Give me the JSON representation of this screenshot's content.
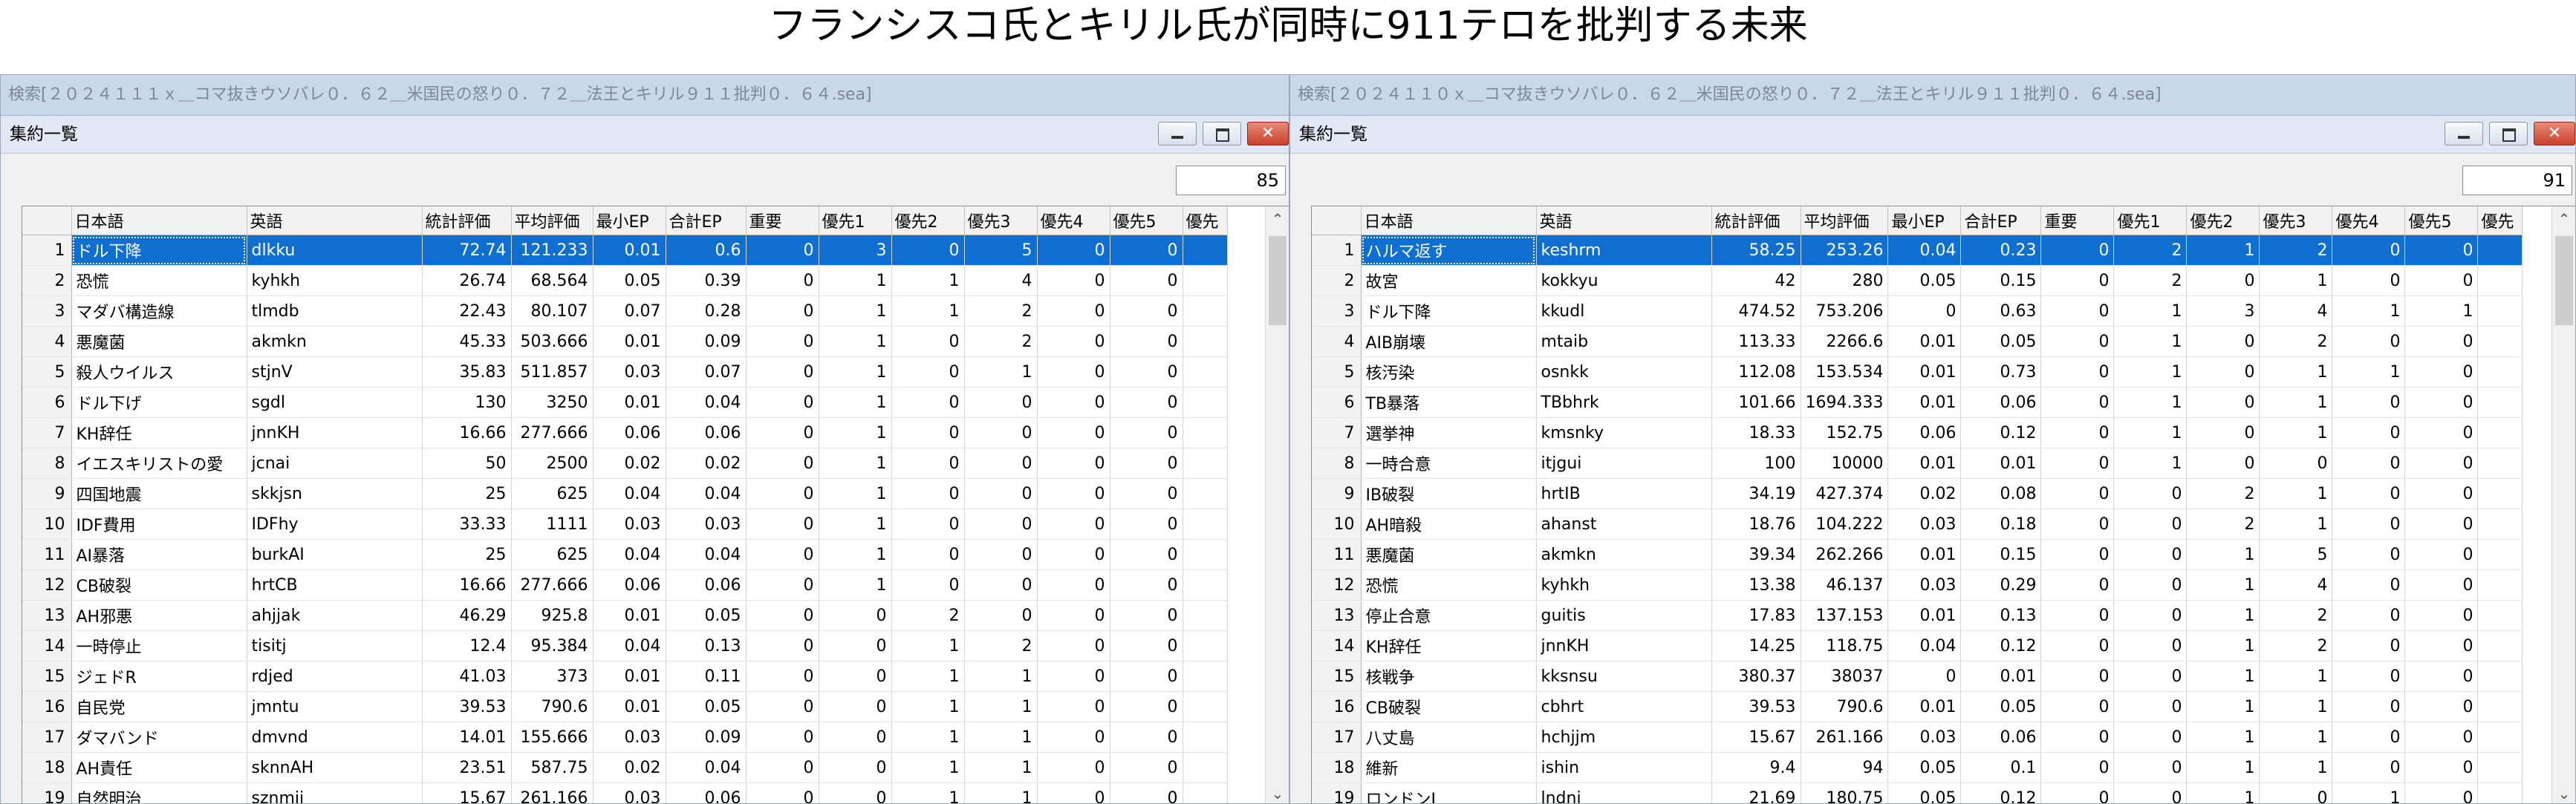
{
  "page_title": "フランシスコ氏とキリル氏が同時に911テロを批判する未来",
  "columns": [
    "日本語",
    "英語",
    "統計評価",
    "平均評価",
    "最小EP",
    "合計EP",
    "重要",
    "優先1",
    "優先2",
    "優先3",
    "優先4",
    "優先5",
    "優先"
  ],
  "panels": [
    {
      "window_title": "検索[２０２４１１１ｘ＿コマ抜きウソバレ０．６２＿米国民の怒り０．７２＿法王とキリル９１１批判０．６４.sea]",
      "subwindow_title": "集約一覧",
      "count": "85",
      "rows": [
        [
          "1",
          "ドル下降",
          "dlkku",
          "72.74",
          "121.233",
          "0.01",
          "0.6",
          "0",
          "3",
          "0",
          "5",
          "0",
          "0"
        ],
        [
          "2",
          "恐慌",
          "kyhkh",
          "26.74",
          "68.564",
          "0.05",
          "0.39",
          "0",
          "1",
          "1",
          "4",
          "0",
          "0"
        ],
        [
          "3",
          "マダバ構造線",
          "tlmdb",
          "22.43",
          "80.107",
          "0.07",
          "0.28",
          "0",
          "1",
          "1",
          "2",
          "0",
          "0"
        ],
        [
          "4",
          "悪魔菌",
          "akmkn",
          "45.33",
          "503.666",
          "0.01",
          "0.09",
          "0",
          "1",
          "0",
          "2",
          "0",
          "0"
        ],
        [
          "5",
          "殺人ウイルス",
          "stjnV",
          "35.83",
          "511.857",
          "0.03",
          "0.07",
          "0",
          "1",
          "0",
          "1",
          "0",
          "0"
        ],
        [
          "6",
          "ドル下げ",
          "sgdl",
          "130",
          "3250",
          "0.01",
          "0.04",
          "0",
          "1",
          "0",
          "0",
          "0",
          "0"
        ],
        [
          "7",
          "KH辞任",
          "jnnKH",
          "16.66",
          "277.666",
          "0.06",
          "0.06",
          "0",
          "1",
          "0",
          "0",
          "0",
          "0"
        ],
        [
          "8",
          "イエスキリストの愛",
          "jcnai",
          "50",
          "2500",
          "0.02",
          "0.02",
          "0",
          "1",
          "0",
          "0",
          "0",
          "0"
        ],
        [
          "9",
          "四国地震",
          "skkjsn",
          "25",
          "625",
          "0.04",
          "0.04",
          "0",
          "1",
          "0",
          "0",
          "0",
          "0"
        ],
        [
          "10",
          "IDF費用",
          "IDFhy",
          "33.33",
          "1111",
          "0.03",
          "0.03",
          "0",
          "1",
          "0",
          "0",
          "0",
          "0"
        ],
        [
          "11",
          "AI暴落",
          "burkAI",
          "25",
          "625",
          "0.04",
          "0.04",
          "0",
          "1",
          "0",
          "0",
          "0",
          "0"
        ],
        [
          "12",
          "CB破裂",
          "hrtCB",
          "16.66",
          "277.666",
          "0.06",
          "0.06",
          "0",
          "1",
          "0",
          "0",
          "0",
          "0"
        ],
        [
          "13",
          "AH邪悪",
          "ahjjak",
          "46.29",
          "925.8",
          "0.01",
          "0.05",
          "0",
          "0",
          "2",
          "0",
          "0",
          "0"
        ],
        [
          "14",
          "一時停止",
          "tisitj",
          "12.4",
          "95.384",
          "0.04",
          "0.13",
          "0",
          "0",
          "1",
          "2",
          "0",
          "0"
        ],
        [
          "15",
          "ジェドR",
          "rdjed",
          "41.03",
          "373",
          "0.01",
          "0.11",
          "0",
          "0",
          "1",
          "1",
          "0",
          "0"
        ],
        [
          "16",
          "自民党",
          "jmntu",
          "39.53",
          "790.6",
          "0.01",
          "0.05",
          "0",
          "0",
          "1",
          "1",
          "0",
          "0"
        ],
        [
          "17",
          "ダマバンド",
          "dmvnd",
          "14.01",
          "155.666",
          "0.03",
          "0.09",
          "0",
          "0",
          "1",
          "1",
          "0",
          "0"
        ],
        [
          "18",
          "AH責任",
          "sknnAH",
          "23.51",
          "587.75",
          "0.02",
          "0.04",
          "0",
          "0",
          "1",
          "1",
          "0",
          "0"
        ],
        [
          "19",
          "自然明治",
          "sznmij",
          "15.67",
          "261.166",
          "0.03",
          "0.06",
          "0",
          "0",
          "1",
          "1",
          "0",
          "0"
        ]
      ]
    },
    {
      "window_title": "検索[２０２４１１０ｘ＿コマ抜きウソバレ０．６２＿米国民の怒り０．７２＿法王とキリル９１１批判０．６４.sea]",
      "subwindow_title": "集約一覧",
      "count": "91",
      "rows": [
        [
          "1",
          "ハルマ返す",
          "keshrm",
          "58.25",
          "253.26",
          "0.04",
          "0.23",
          "0",
          "2",
          "1",
          "2",
          "0",
          "0"
        ],
        [
          "2",
          "故宮",
          "kokkyu",
          "42",
          "280",
          "0.05",
          "0.15",
          "0",
          "2",
          "0",
          "1",
          "0",
          "0"
        ],
        [
          "3",
          "ドル下降",
          "kkudl",
          "474.52",
          "753.206",
          "0",
          "0.63",
          "0",
          "1",
          "3",
          "4",
          "1",
          "1"
        ],
        [
          "4",
          "AIB崩壊",
          "mtaib",
          "113.33",
          "2266.6",
          "0.01",
          "0.05",
          "0",
          "1",
          "0",
          "2",
          "0",
          "0"
        ],
        [
          "5",
          "核汚染",
          "osnkk",
          "112.08",
          "153.534",
          "0.01",
          "0.73",
          "0",
          "1",
          "0",
          "1",
          "1",
          "0"
        ],
        [
          "6",
          "TB暴落",
          "TBbhrk",
          "101.66",
          "1694.333",
          "0.01",
          "0.06",
          "0",
          "1",
          "0",
          "1",
          "0",
          "0"
        ],
        [
          "7",
          "選挙神",
          "kmsnky",
          "18.33",
          "152.75",
          "0.06",
          "0.12",
          "0",
          "1",
          "0",
          "1",
          "0",
          "0"
        ],
        [
          "8",
          "一時合意",
          "itjgui",
          "100",
          "10000",
          "0.01",
          "0.01",
          "0",
          "1",
          "0",
          "0",
          "0",
          "0"
        ],
        [
          "9",
          "IB破裂",
          "hrtIB",
          "34.19",
          "427.374",
          "0.02",
          "0.08",
          "0",
          "0",
          "2",
          "1",
          "0",
          "0"
        ],
        [
          "10",
          "AH暗殺",
          "ahanst",
          "18.76",
          "104.222",
          "0.03",
          "0.18",
          "0",
          "0",
          "2",
          "1",
          "0",
          "0"
        ],
        [
          "11",
          "悪魔菌",
          "akmkn",
          "39.34",
          "262.266",
          "0.01",
          "0.15",
          "0",
          "0",
          "1",
          "5",
          "0",
          "0"
        ],
        [
          "12",
          "恐慌",
          "kyhkh",
          "13.38",
          "46.137",
          "0.03",
          "0.29",
          "0",
          "0",
          "1",
          "4",
          "0",
          "0"
        ],
        [
          "13",
          "停止合意",
          "guitis",
          "17.83",
          "137.153",
          "0.01",
          "0.13",
          "0",
          "0",
          "1",
          "2",
          "0",
          "0"
        ],
        [
          "14",
          "KH辞任",
          "jnnKH",
          "14.25",
          "118.75",
          "0.04",
          "0.12",
          "0",
          "0",
          "1",
          "2",
          "0",
          "0"
        ],
        [
          "15",
          "核戦争",
          "kksnsu",
          "380.37",
          "38037",
          "0",
          "0.01",
          "0",
          "0",
          "1",
          "1",
          "0",
          "0"
        ],
        [
          "16",
          "CB破裂",
          "cbhrt",
          "39.53",
          "790.6",
          "0.01",
          "0.05",
          "0",
          "0",
          "1",
          "1",
          "0",
          "0"
        ],
        [
          "17",
          "八丈島",
          "hchjjm",
          "15.67",
          "261.166",
          "0.03",
          "0.06",
          "0",
          "0",
          "1",
          "1",
          "0",
          "0"
        ],
        [
          "18",
          "維新",
          "ishin",
          "9.4",
          "94",
          "0.05",
          "0.1",
          "0",
          "0",
          "1",
          "1",
          "0",
          "0"
        ],
        [
          "19",
          "ロンドンJ",
          "lndnj",
          "21.69",
          "180.75",
          "0.05",
          "0.12",
          "0",
          "0",
          "1",
          "0",
          "1",
          "0"
        ]
      ]
    }
  ]
}
